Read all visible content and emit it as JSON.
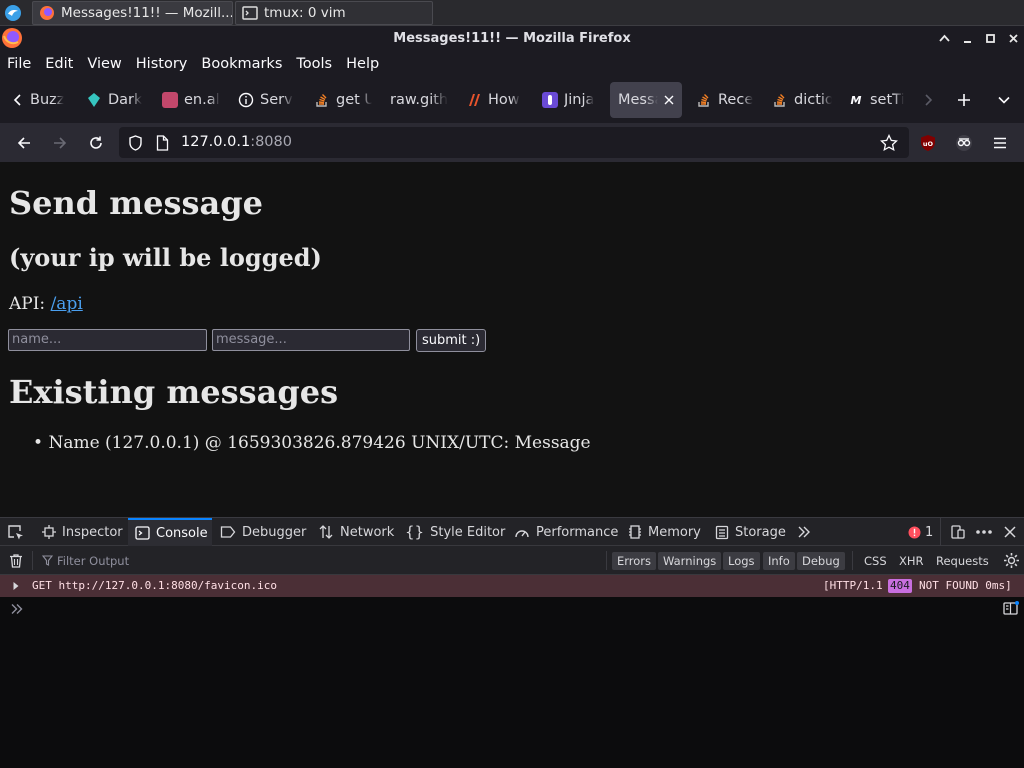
{
  "taskbar": {
    "tasks": [
      {
        "title": "Messages!11!! — Mozill...",
        "icon": "firefox-icon"
      },
      {
        "title": "tmux: 0 vim",
        "icon": "terminal-icon"
      }
    ]
  },
  "window": {
    "title": "Messages!11!! — Mozilla Firefox"
  },
  "menubar": {
    "items": [
      "File",
      "Edit",
      "View",
      "History",
      "Bookmarks",
      "Tools",
      "Help"
    ]
  },
  "tabs": [
    {
      "label": "Buzz",
      "icon": "buzz-icon"
    },
    {
      "label": "Dark",
      "icon": "dark-icon"
    },
    {
      "label": "en.al",
      "icon": "anime-icon"
    },
    {
      "label": "Serv",
      "icon": "info-icon"
    },
    {
      "label": "get U",
      "icon": "stackoverflow-icon"
    },
    {
      "label": "raw.gith",
      "icon": "none"
    },
    {
      "label": "How",
      "icon": "how-icon"
    },
    {
      "label": "Jinja",
      "icon": "jinja-icon"
    },
    {
      "label": "Messa",
      "icon": "none",
      "active": true
    },
    {
      "label": "Rece",
      "icon": "stackoverflow-icon"
    },
    {
      "label": "dictio",
      "icon": "stackoverflow-icon"
    },
    {
      "label": "setTi",
      "icon": "mdn-icon"
    }
  ],
  "navbar": {
    "url_host": "127.0.0.1",
    "url_port": ":8080"
  },
  "page": {
    "heading": "Send message",
    "subheading": "(your ip will be logged)",
    "api_label": "API:",
    "api_link": "/api",
    "name_placeholder": "name...",
    "message_placeholder": "message...",
    "submit_label": "submit :)",
    "existing_heading": "Existing messages",
    "messages": [
      "Name (127.0.0.1) @ 1659303826.879426 UNIX/UTC: Message"
    ]
  },
  "devtools": {
    "tabs": [
      "Inspector",
      "Console",
      "Debugger",
      "Network",
      "Style Editor",
      "Performance",
      "Memory",
      "Storage"
    ],
    "active_tab": "Console",
    "error_count": "1",
    "filter_placeholder": "Filter Output",
    "levels": [
      "Errors",
      "Warnings",
      "Logs",
      "Info",
      "Debug"
    ],
    "types": [
      "CSS",
      "XHR",
      "Requests"
    ],
    "log": {
      "method_url": "GET http://127.0.0.1:8080/favicon.ico",
      "protocol": "[HTTP/1.1",
      "status": "404",
      "status_text": "NOT FOUND 0ms]"
    }
  },
  "colors": {
    "link": "#4a9fef",
    "error_bg": "#4b2f36",
    "status_badge": "#c96fe0",
    "active_tab_line": "#0a84ff"
  }
}
